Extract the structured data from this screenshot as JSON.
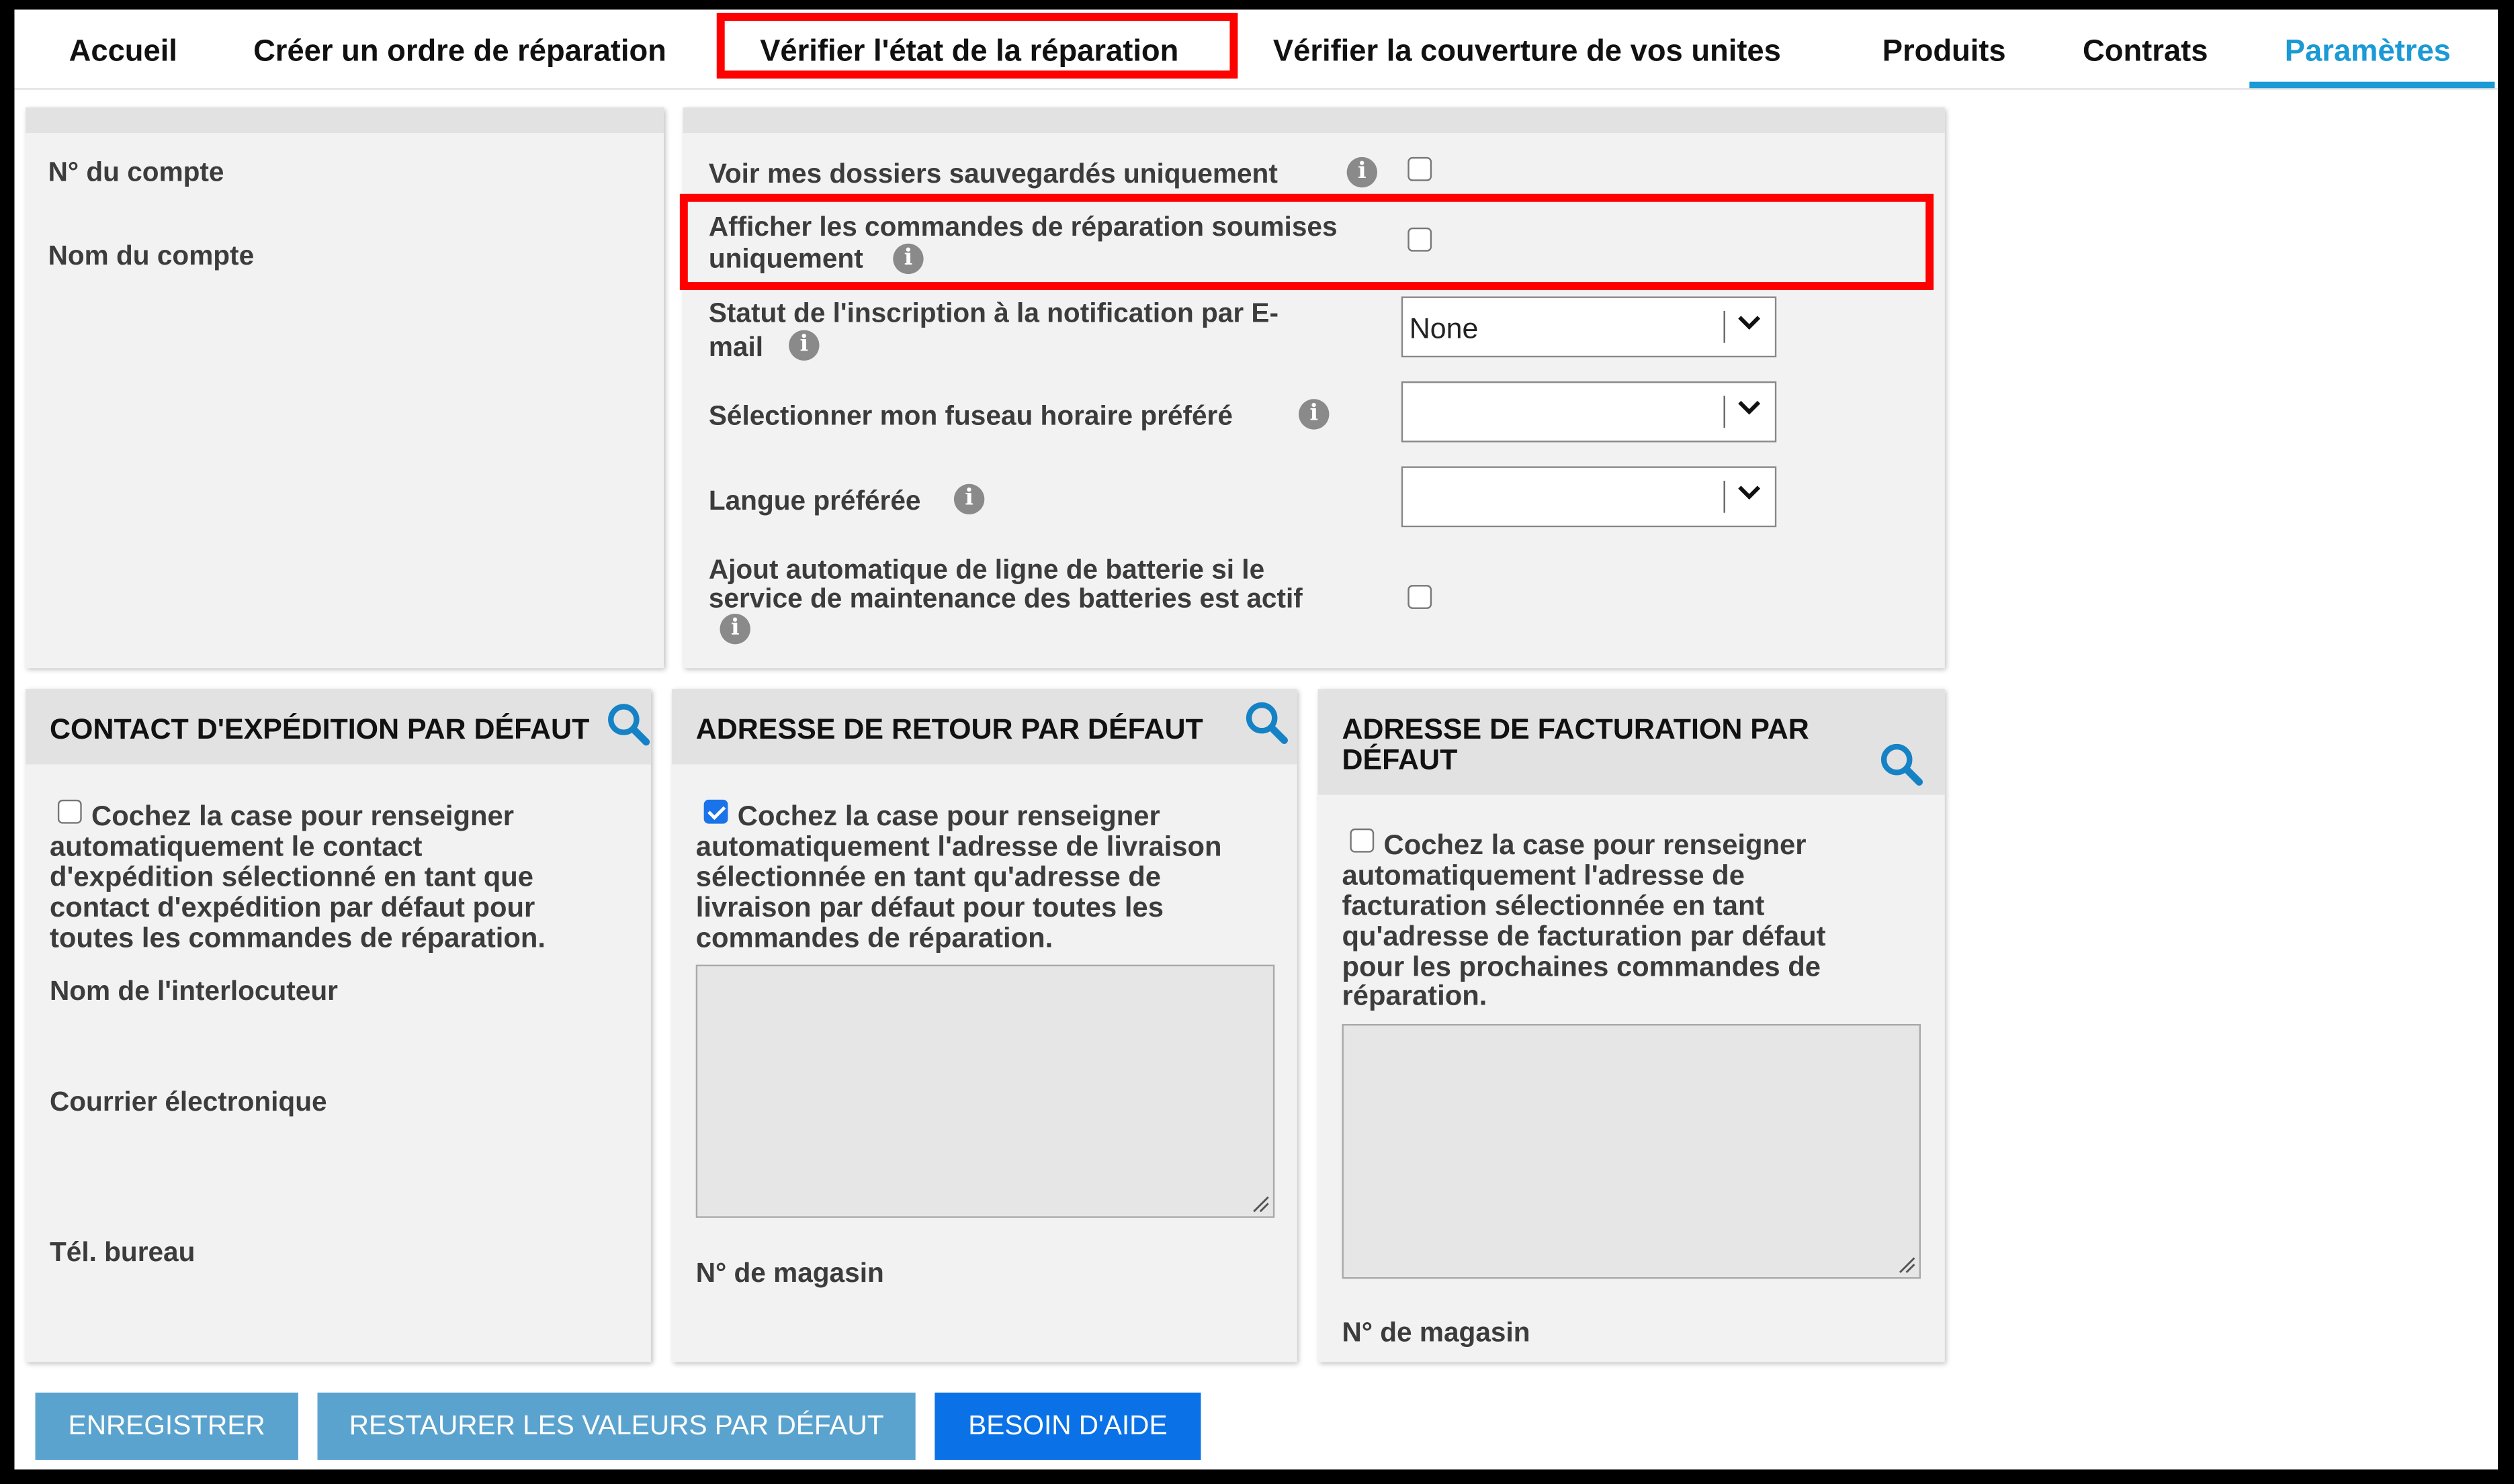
{
  "tabs": [
    {
      "label": "Accueil"
    },
    {
      "label": "Créer un ordre de réparation"
    },
    {
      "label": "Vérifier l'état de la réparation"
    },
    {
      "label": "Vérifier la couverture de vos unites"
    },
    {
      "label": "Produits"
    },
    {
      "label": "Contrats"
    },
    {
      "label": "Paramètres"
    }
  ],
  "account": {
    "number_label": "N° du compte",
    "name_label": "Nom du compte"
  },
  "settings": {
    "saved_only_label": "Voir mes dossiers sauvegardés uniquement",
    "submitted_only_label_1": "Afficher les commandes de réparation soumises",
    "submitted_only_label_2": "uniquement",
    "email_status_label_1": "Statut de l'inscription à la notification par E-",
    "email_status_label_2": "mail",
    "email_status_value": "None",
    "timezone_label": "Sélectionner mon fuseau horaire préféré",
    "timezone_value": "",
    "language_label": "Langue préférée",
    "language_value": "",
    "battery_label_1": "Ajout automatique de ligne de batterie si le",
    "battery_label_2": "service de maintenance des batteries est actif"
  },
  "shipping": {
    "title": "CONTACT D'EXPÉDITION PAR DÉFAUT",
    "desc": [
      "Cochez la case pour renseigner",
      "automatiquement le contact",
      "d'expédition sélectionné en tant que",
      "contact d'expédition par défaut pour",
      "toutes les commandes de réparation."
    ],
    "checked": false,
    "contact_label": "Nom de l'interlocuteur",
    "email_label": "Courrier électronique",
    "phone_label": "Tél. bureau"
  },
  "return": {
    "title": "ADRESSE DE RETOUR PAR DÉFAUT",
    "desc": [
      "Cochez la case pour renseigner",
      "automatiquement l'adresse de livraison",
      "sélectionnée en tant qu'adresse de",
      "livraison par défaut pour toutes les",
      "commandes de réparation."
    ],
    "checked": true,
    "store_label": "N° de magasin"
  },
  "billing": {
    "title_1": "ADRESSE DE FACTURATION PAR",
    "title_2": "DÉFAUT",
    "desc": [
      "Cochez la case pour renseigner",
      "automatiquement l'adresse de",
      "facturation sélectionnée en tant",
      "qu'adresse de facturation par défaut",
      "pour les prochaines commandes de",
      "réparation."
    ],
    "checked": false,
    "store_label": "N° de magasin"
  },
  "buttons": {
    "save": "ENREGISTRER",
    "restore": "RESTAURER LES VALEURS PAR DÉFAUT",
    "help": "BESOIN D'AIDE"
  },
  "colors": {
    "accent": "#1b9ad6",
    "highlight": "#ff0000",
    "button_muted": "#5ba3cf",
    "button_primary": "#0a72e6"
  },
  "icons": [
    "info-icon",
    "search-icon",
    "chevron-down-icon",
    "resize-grip-icon"
  ]
}
